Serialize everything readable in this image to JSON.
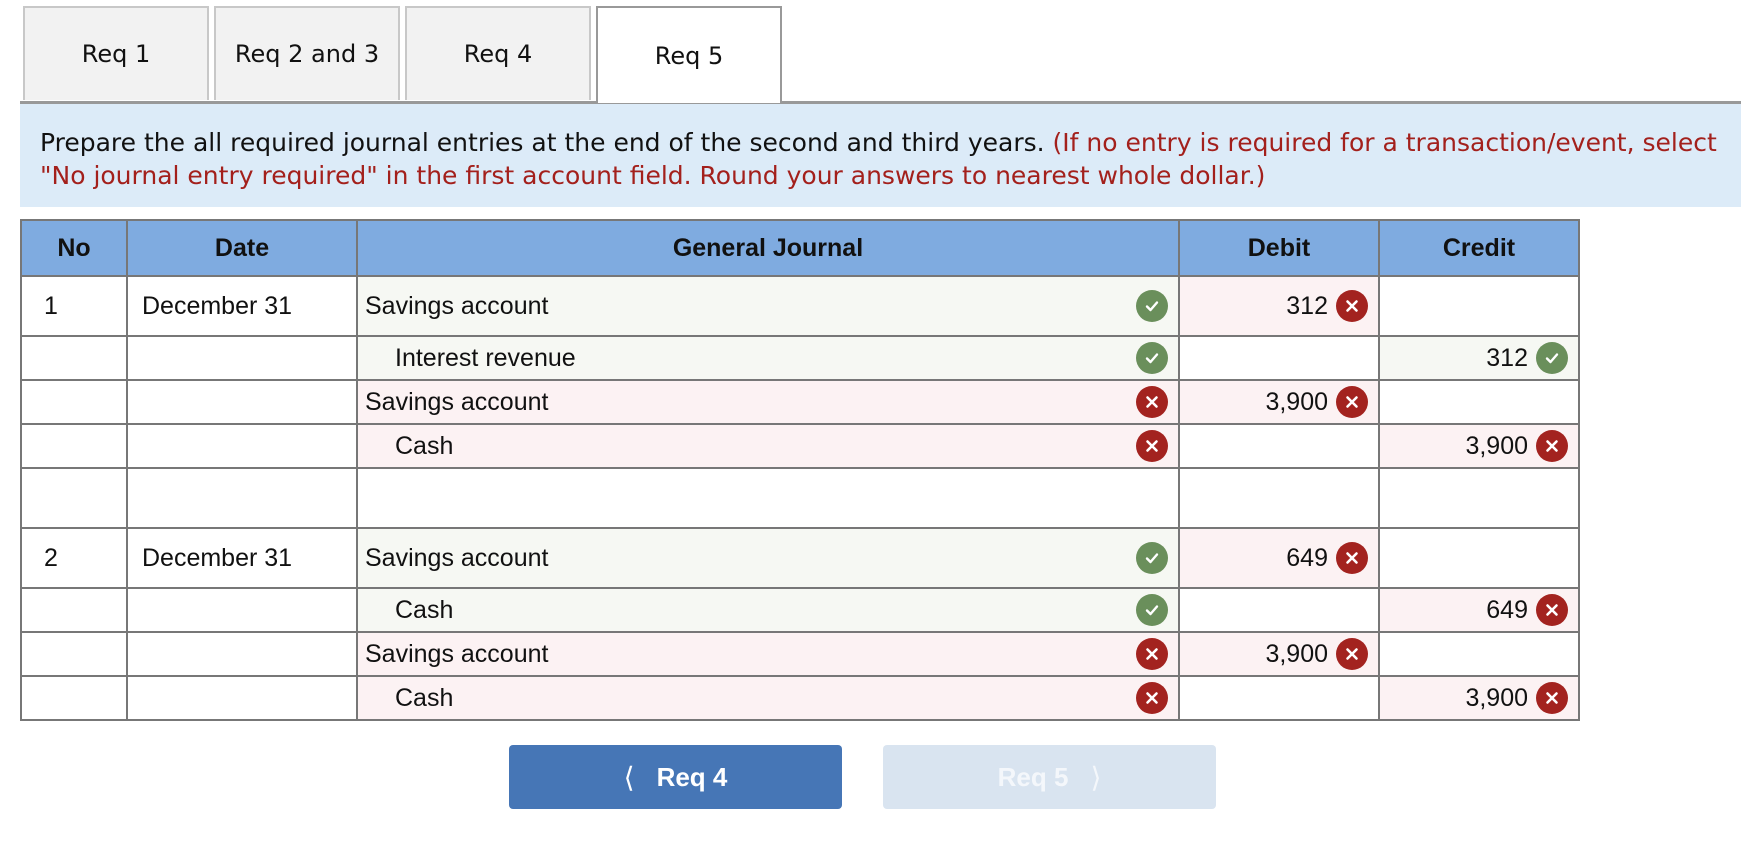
{
  "tabs": [
    {
      "label": "Req 1",
      "active": false
    },
    {
      "label": "Req 2 and 3",
      "active": false
    },
    {
      "label": "Req 4",
      "active": false
    },
    {
      "label": "Req 5",
      "active": true
    }
  ],
  "instructions": {
    "main": "Prepare the all required journal entries at the end of the second and third years. ",
    "note": "(If no entry is required for a transaction/event, select \"No journal entry required\" in the first account field. Round your answers to nearest whole dollar.)"
  },
  "table": {
    "headers": {
      "no": "No",
      "date": "Date",
      "journal": "General Journal",
      "debit": "Debit",
      "credit": "Credit"
    },
    "rows": [
      {
        "no": "1",
        "date": "December 31",
        "account": "Savings account",
        "indent": false,
        "account_status": "correct",
        "debit": "312",
        "debit_status": "incorrect",
        "credit": "",
        "credit_status": ""
      },
      {
        "no": "",
        "date": "",
        "account": "Interest revenue",
        "indent": true,
        "account_status": "correct",
        "debit": "",
        "debit_status": "",
        "credit": "312",
        "credit_status": "correct"
      },
      {
        "no": "",
        "date": "",
        "account": "Savings account",
        "indent": false,
        "account_status": "incorrect",
        "debit": "3,900",
        "debit_status": "incorrect",
        "credit": "",
        "credit_status": ""
      },
      {
        "no": "",
        "date": "",
        "account": "Cash",
        "indent": true,
        "account_status": "incorrect",
        "debit": "",
        "debit_status": "",
        "credit": "3,900",
        "credit_status": "incorrect"
      },
      {
        "no": "",
        "date": "",
        "account": "",
        "indent": false,
        "account_status": "",
        "debit": "",
        "debit_status": "",
        "credit": "",
        "credit_status": ""
      },
      {
        "no": "2",
        "date": "December 31",
        "account": "Savings account",
        "indent": false,
        "account_status": "correct",
        "debit": "649",
        "debit_status": "incorrect",
        "credit": "",
        "credit_status": ""
      },
      {
        "no": "",
        "date": "",
        "account": "Cash",
        "indent": true,
        "account_status": "correct",
        "debit": "",
        "debit_status": "",
        "credit": "649",
        "credit_status": "incorrect"
      },
      {
        "no": "",
        "date": "",
        "account": "Savings account",
        "indent": false,
        "account_status": "incorrect",
        "debit": "3,900",
        "debit_status": "incorrect",
        "credit": "",
        "credit_status": ""
      },
      {
        "no": "",
        "date": "",
        "account": "Cash",
        "indent": true,
        "account_status": "incorrect",
        "debit": "",
        "debit_status": "",
        "credit": "3,900",
        "credit_status": "incorrect"
      }
    ]
  },
  "nav": {
    "prev_label": "Req 4",
    "next_label": "Req 5",
    "prev_icon": "chevron-left-icon",
    "next_icon": "chevron-right-icon"
  },
  "colors": {
    "correct": "#6a8f5b",
    "incorrect": "#a3231f",
    "header_bg": "#7fabe0",
    "instruction_bg": "#dcebf8",
    "note_text": "#a3201c",
    "prev_button": "#4676b6",
    "next_button_disabled": "#d9e4f0"
  }
}
